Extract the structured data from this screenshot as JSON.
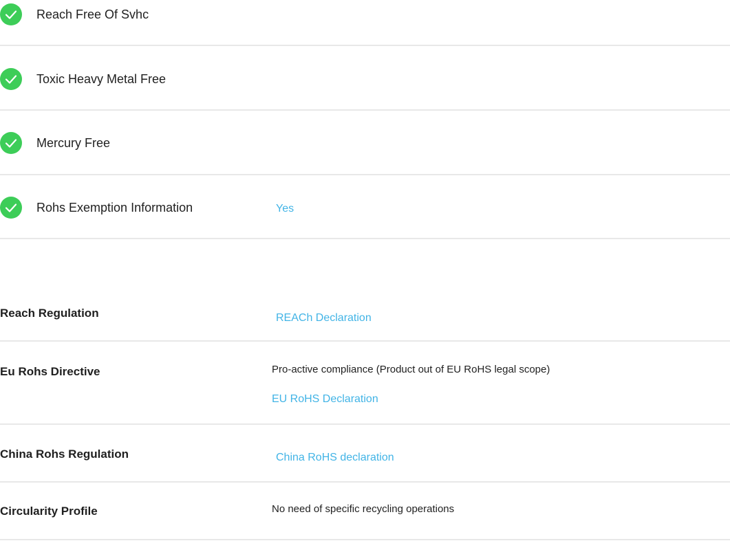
{
  "features": [
    {
      "label": "Reach Free Of Svhc",
      "value": ""
    },
    {
      "label": "Toxic Heavy Metal Free",
      "value": ""
    },
    {
      "label": "Mercury Free",
      "value": ""
    },
    {
      "label": "Rohs Exemption Information",
      "value": "Yes"
    }
  ],
  "regulations": [
    {
      "label": "Reach Regulation",
      "text": "",
      "link": "REACh Declaration"
    },
    {
      "label": "Eu Rohs Directive",
      "text": "Pro-active compliance (Product out of EU RoHS legal scope)",
      "link": "EU RoHS Declaration"
    },
    {
      "label": "China Rohs Regulation",
      "text": "",
      "link": "China RoHS declaration"
    },
    {
      "label": "Circularity Profile",
      "text": "No need of specific recycling operations",
      "link": ""
    }
  ],
  "colors": {
    "check": "#3dcd58",
    "link": "#42b4e6",
    "divider": "#e8e8e8"
  },
  "icons": {
    "feature_status": "check-circle-icon"
  }
}
